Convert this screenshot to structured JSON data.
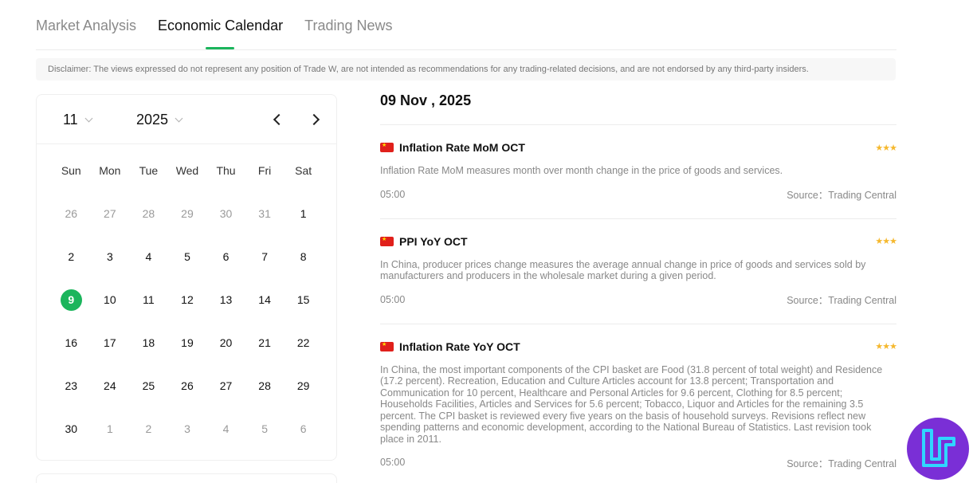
{
  "tabs": [
    {
      "label": "Market Analysis",
      "active": false
    },
    {
      "label": "Economic Calendar",
      "active": true
    },
    {
      "label": "Trading News",
      "active": false
    }
  ],
  "disclaimer": "Disclaimer: The views expressed do not represent any position of Trade W, are not intended as recommendations for any trading-related decisions, and are not endorsed by any third-party insiders.",
  "calendar": {
    "month": "11",
    "year": "2025",
    "weekdays": [
      "Sun",
      "Mon",
      "Tue",
      "Wed",
      "Thu",
      "Fri",
      "Sat"
    ],
    "weeks": [
      [
        {
          "d": "26",
          "m": true
        },
        {
          "d": "27",
          "m": true
        },
        {
          "d": "28",
          "m": true
        },
        {
          "d": "29",
          "m": true
        },
        {
          "d": "30",
          "m": true
        },
        {
          "d": "31",
          "m": true
        },
        {
          "d": "1"
        }
      ],
      [
        {
          "d": "2"
        },
        {
          "d": "3"
        },
        {
          "d": "4"
        },
        {
          "d": "5"
        },
        {
          "d": "6"
        },
        {
          "d": "7"
        },
        {
          "d": "8"
        }
      ],
      [
        {
          "d": "9",
          "s": true
        },
        {
          "d": "10"
        },
        {
          "d": "11"
        },
        {
          "d": "12"
        },
        {
          "d": "13"
        },
        {
          "d": "14"
        },
        {
          "d": "15"
        }
      ],
      [
        {
          "d": "16"
        },
        {
          "d": "17"
        },
        {
          "d": "18"
        },
        {
          "d": "19"
        },
        {
          "d": "20"
        },
        {
          "d": "21"
        },
        {
          "d": "22"
        }
      ],
      [
        {
          "d": "23"
        },
        {
          "d": "24"
        },
        {
          "d": "25"
        },
        {
          "d": "26"
        },
        {
          "d": "27"
        },
        {
          "d": "28"
        },
        {
          "d": "29"
        }
      ],
      [
        {
          "d": "30"
        },
        {
          "d": "1",
          "m": true
        },
        {
          "d": "2",
          "m": true
        },
        {
          "d": "3",
          "m": true
        },
        {
          "d": "4",
          "m": true
        },
        {
          "d": "5",
          "m": true
        },
        {
          "d": "6",
          "m": true
        }
      ]
    ],
    "selected_color": "#1bb55c"
  },
  "date_title": "09 Nov , 2025",
  "events": [
    {
      "flag": "china-flag-icon",
      "title": "Inflation Rate MoM OCT",
      "stars": "★★★",
      "importance": 3,
      "description": "Inflation Rate MoM measures month over month change in the price of goods and services.",
      "time": "05:00",
      "source": "Source：Trading Central"
    },
    {
      "flag": "china-flag-icon",
      "title": "PPI YoY OCT",
      "stars": "★★★",
      "importance": 3,
      "description": "In China, producer prices change measures the average annual change in price of goods and services sold by manufacturers and producers in the wholesale market during a given period.",
      "time": "05:00",
      "source": "Source：Trading Central"
    },
    {
      "flag": "china-flag-icon",
      "title": "Inflation Rate YoY OCT",
      "stars": "★★★",
      "importance": 3,
      "description": "In China, the most important components of the CPI basket are Food (31.8 percent of total weight) and Residence (17.2 percent). Recreation, Education and Culture Articles account for 13.8 percent; Transportation and Communication for 10 percent, Healthcare and Personal Articles for 9.6 percent, Clothing for 8.5 percent; Households Facilities, Articles and Services for 5.6 percent; Tobacco, Liquor and Articles for the remaining 3.5 percent. The CPI basket is reviewed every five years on the basis of household surveys. Revisions reflect new spending patterns and economic development, according to the National Bureau of Statistics. Last revision took place in 2011.",
      "time": "05:00",
      "source": "Source：Trading Central"
    }
  ],
  "colors": {
    "accent": "#1bb55c",
    "stars": "#f5b82e",
    "logo_bg": "#7a2fd6"
  }
}
